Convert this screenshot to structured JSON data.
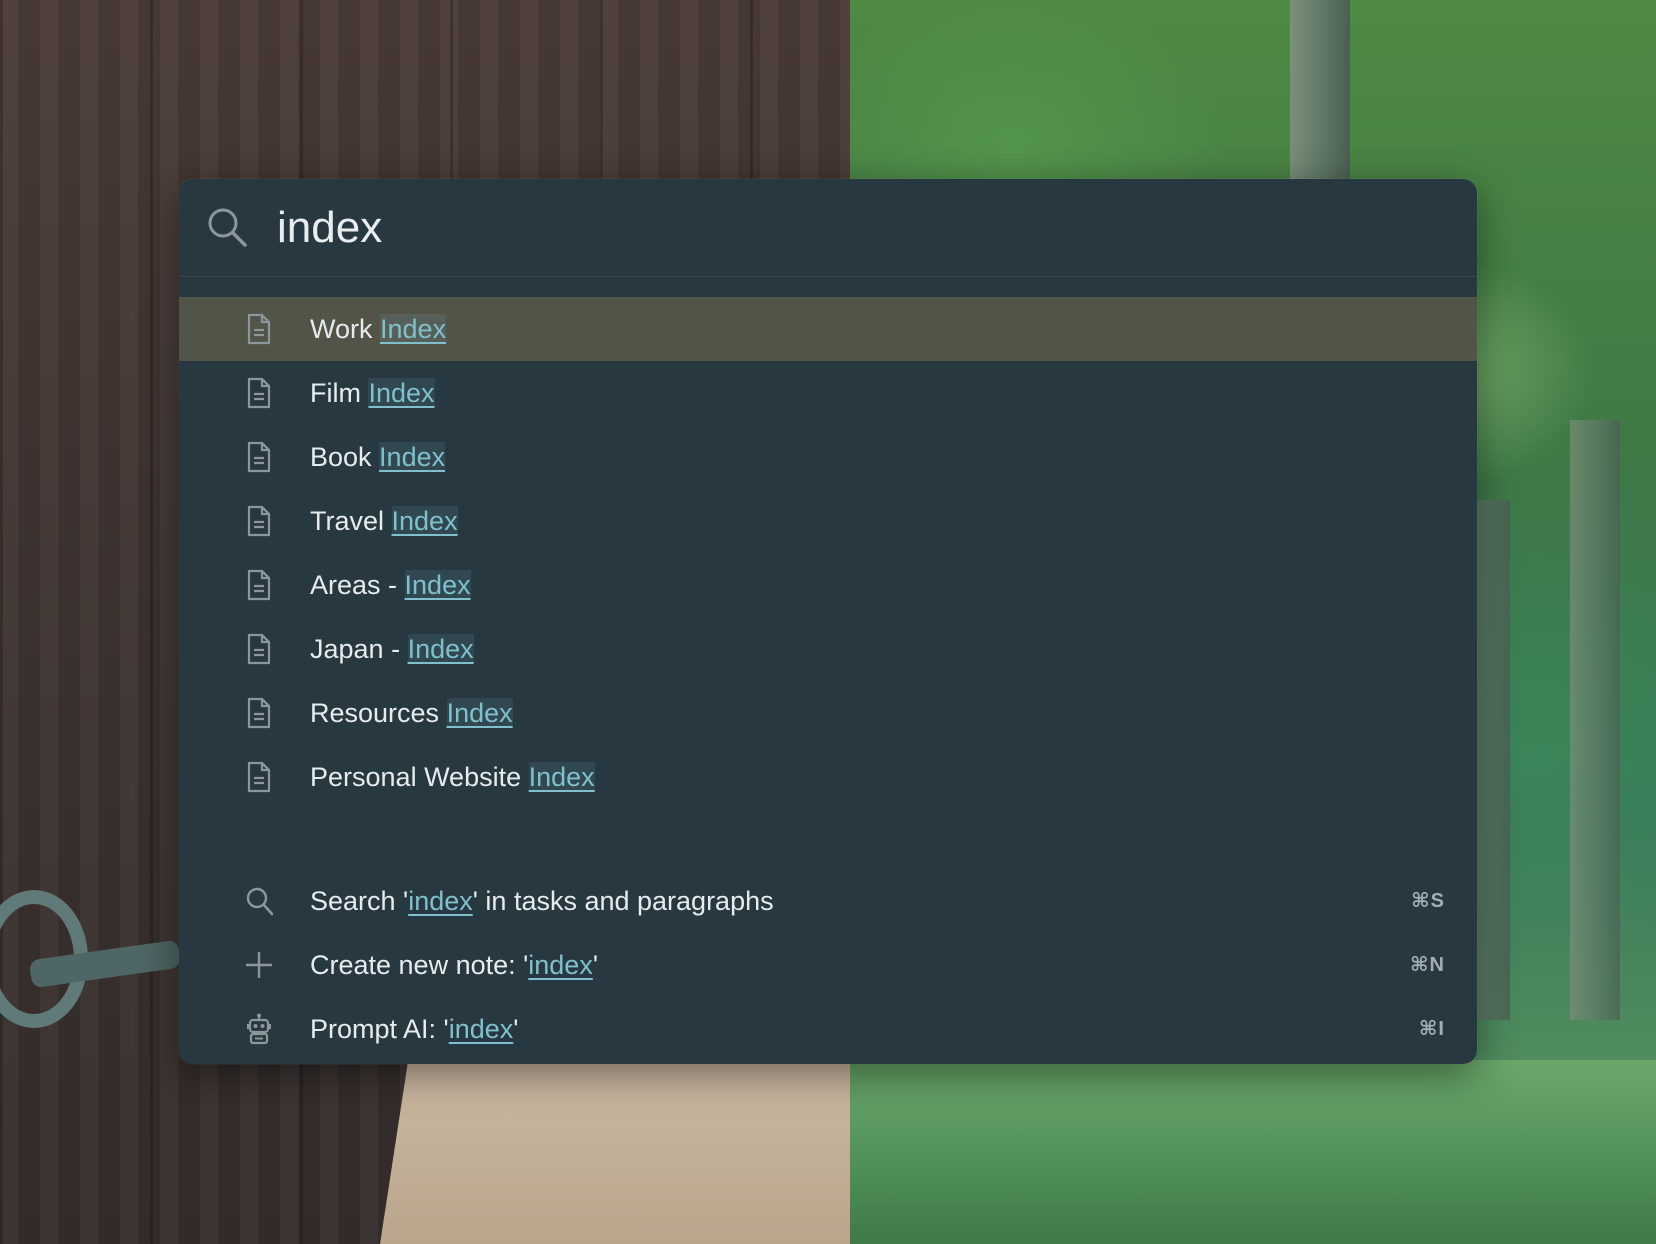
{
  "search": {
    "query": "index",
    "icon": "search-icon"
  },
  "results": [
    {
      "label": "Work Index",
      "icon": "document-icon",
      "selected": true
    },
    {
      "label": "Film Index",
      "icon": "document-icon",
      "selected": false
    },
    {
      "label": "Book Index",
      "icon": "document-icon",
      "selected": false
    },
    {
      "label": "Travel Index",
      "icon": "document-icon",
      "selected": false
    },
    {
      "label": "Areas - Index",
      "icon": "document-icon",
      "selected": false
    },
    {
      "label": "Japan - Index",
      "icon": "document-icon",
      "selected": false
    },
    {
      "label": "Resources Index",
      "icon": "document-icon",
      "selected": false
    },
    {
      "label": "Personal Website Index",
      "icon": "document-icon",
      "selected": false
    }
  ],
  "actions": [
    {
      "prefix": "Search '",
      "term": "index",
      "suffix": "' in tasks and paragraphs",
      "shortcut": "⌘S",
      "icon": "search-icon"
    },
    {
      "prefix": "Create new note: '",
      "term": "index",
      "suffix": "'",
      "shortcut": "⌘N",
      "icon": "plus-icon"
    },
    {
      "prefix": "Prompt AI: '",
      "term": "index",
      "suffix": "'",
      "shortcut": "⌘I",
      "icon": "robot-icon"
    }
  ],
  "colors": {
    "panel": "#283840",
    "selected_row": "#525448",
    "highlight": "#7fc0cc",
    "text": "#e6ecee"
  }
}
